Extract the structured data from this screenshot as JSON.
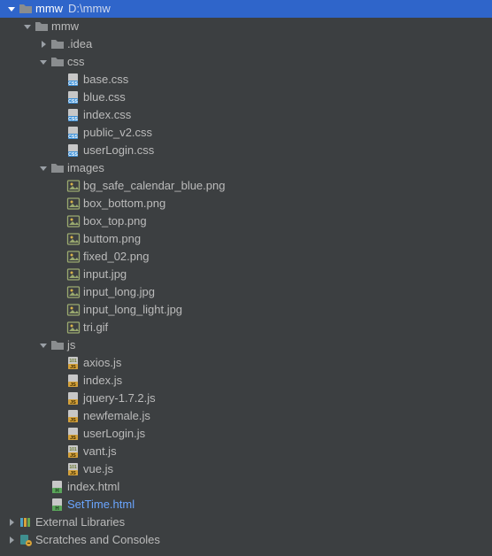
{
  "project": {
    "name": "mmw",
    "path": "D:\\mmw"
  },
  "tree": [
    {
      "depth": 0,
      "arrow": "down",
      "icon": "folder",
      "label": "mmw",
      "extra": "D:\\mmw",
      "root": true,
      "interact": true,
      "name": "project-root"
    },
    {
      "depth": 1,
      "arrow": "down",
      "icon": "folder",
      "label": "mmw",
      "interact": true,
      "name": "folder-mmw"
    },
    {
      "depth": 2,
      "arrow": "right",
      "icon": "folder",
      "label": ".idea",
      "interact": true,
      "name": "folder-idea"
    },
    {
      "depth": 2,
      "arrow": "down",
      "icon": "folder",
      "label": "css",
      "interact": true,
      "name": "folder-css"
    },
    {
      "depth": 3,
      "arrow": "",
      "icon": "css",
      "label": "base.css",
      "interact": true,
      "name": "file-base-css"
    },
    {
      "depth": 3,
      "arrow": "",
      "icon": "css",
      "label": "blue.css",
      "interact": true,
      "name": "file-blue-css"
    },
    {
      "depth": 3,
      "arrow": "",
      "icon": "css",
      "label": "index.css",
      "interact": true,
      "name": "file-index-css"
    },
    {
      "depth": 3,
      "arrow": "",
      "icon": "css",
      "label": "public_v2.css",
      "interact": true,
      "name": "file-public-v2-css"
    },
    {
      "depth": 3,
      "arrow": "",
      "icon": "css",
      "label": "userLogin.css",
      "interact": true,
      "name": "file-userlogin-css"
    },
    {
      "depth": 2,
      "arrow": "down",
      "icon": "folder",
      "label": "images",
      "interact": true,
      "name": "folder-images"
    },
    {
      "depth": 3,
      "arrow": "",
      "icon": "image",
      "label": "bg_safe_calendar_blue.png",
      "interact": true,
      "name": "file-bg-safe"
    },
    {
      "depth": 3,
      "arrow": "",
      "icon": "image",
      "label": "box_bottom.png",
      "interact": true,
      "name": "file-box-bottom"
    },
    {
      "depth": 3,
      "arrow": "",
      "icon": "image",
      "label": "box_top.png",
      "interact": true,
      "name": "file-box-top"
    },
    {
      "depth": 3,
      "arrow": "",
      "icon": "image",
      "label": "buttom.png",
      "interact": true,
      "name": "file-buttom"
    },
    {
      "depth": 3,
      "arrow": "",
      "icon": "image",
      "label": "fixed_02.png",
      "interact": true,
      "name": "file-fixed-02"
    },
    {
      "depth": 3,
      "arrow": "",
      "icon": "image",
      "label": "input.jpg",
      "interact": true,
      "name": "file-input"
    },
    {
      "depth": 3,
      "arrow": "",
      "icon": "image",
      "label": "input_long.jpg",
      "interact": true,
      "name": "file-input-long"
    },
    {
      "depth": 3,
      "arrow": "",
      "icon": "image",
      "label": "input_long_light.jpg",
      "interact": true,
      "name": "file-input-long-light"
    },
    {
      "depth": 3,
      "arrow": "",
      "icon": "image",
      "label": "tri.gif",
      "interact": true,
      "name": "file-tri"
    },
    {
      "depth": 2,
      "arrow": "down",
      "icon": "folder",
      "label": "js",
      "interact": true,
      "name": "folder-js"
    },
    {
      "depth": 3,
      "arrow": "",
      "icon": "js101",
      "label": "axios.js",
      "interact": true,
      "name": "file-axios"
    },
    {
      "depth": 3,
      "arrow": "",
      "icon": "js",
      "label": "index.js",
      "interact": true,
      "name": "file-index-js"
    },
    {
      "depth": 3,
      "arrow": "",
      "icon": "js",
      "label": "jquery-1.7.2.js",
      "interact": true,
      "name": "file-jquery"
    },
    {
      "depth": 3,
      "arrow": "",
      "icon": "js",
      "label": "newfemale.js",
      "interact": true,
      "name": "file-newfemale"
    },
    {
      "depth": 3,
      "arrow": "",
      "icon": "js",
      "label": "userLogin.js",
      "interact": true,
      "name": "file-userlogin-js"
    },
    {
      "depth": 3,
      "arrow": "",
      "icon": "js101",
      "label": "vant.js",
      "interact": true,
      "name": "file-vant"
    },
    {
      "depth": 3,
      "arrow": "",
      "icon": "js101",
      "label": "vue.js",
      "interact": true,
      "name": "file-vue"
    },
    {
      "depth": 2,
      "arrow": "",
      "icon": "html",
      "label": "index.html",
      "interact": true,
      "name": "file-index-html"
    },
    {
      "depth": 2,
      "arrow": "",
      "icon": "html",
      "label": "SetTime.html",
      "interact": true,
      "selected": true,
      "name": "file-settime-html"
    },
    {
      "depth": 0,
      "arrow": "right",
      "icon": "libraries",
      "label": "External Libraries",
      "interact": true,
      "name": "external-libraries"
    },
    {
      "depth": 0,
      "arrow": "right",
      "icon": "scratches",
      "label": "Scratches and Consoles",
      "interact": true,
      "name": "scratches-and-consoles"
    }
  ],
  "indent": {
    "base": 6,
    "step": 18,
    "arrowWidth": 14
  }
}
